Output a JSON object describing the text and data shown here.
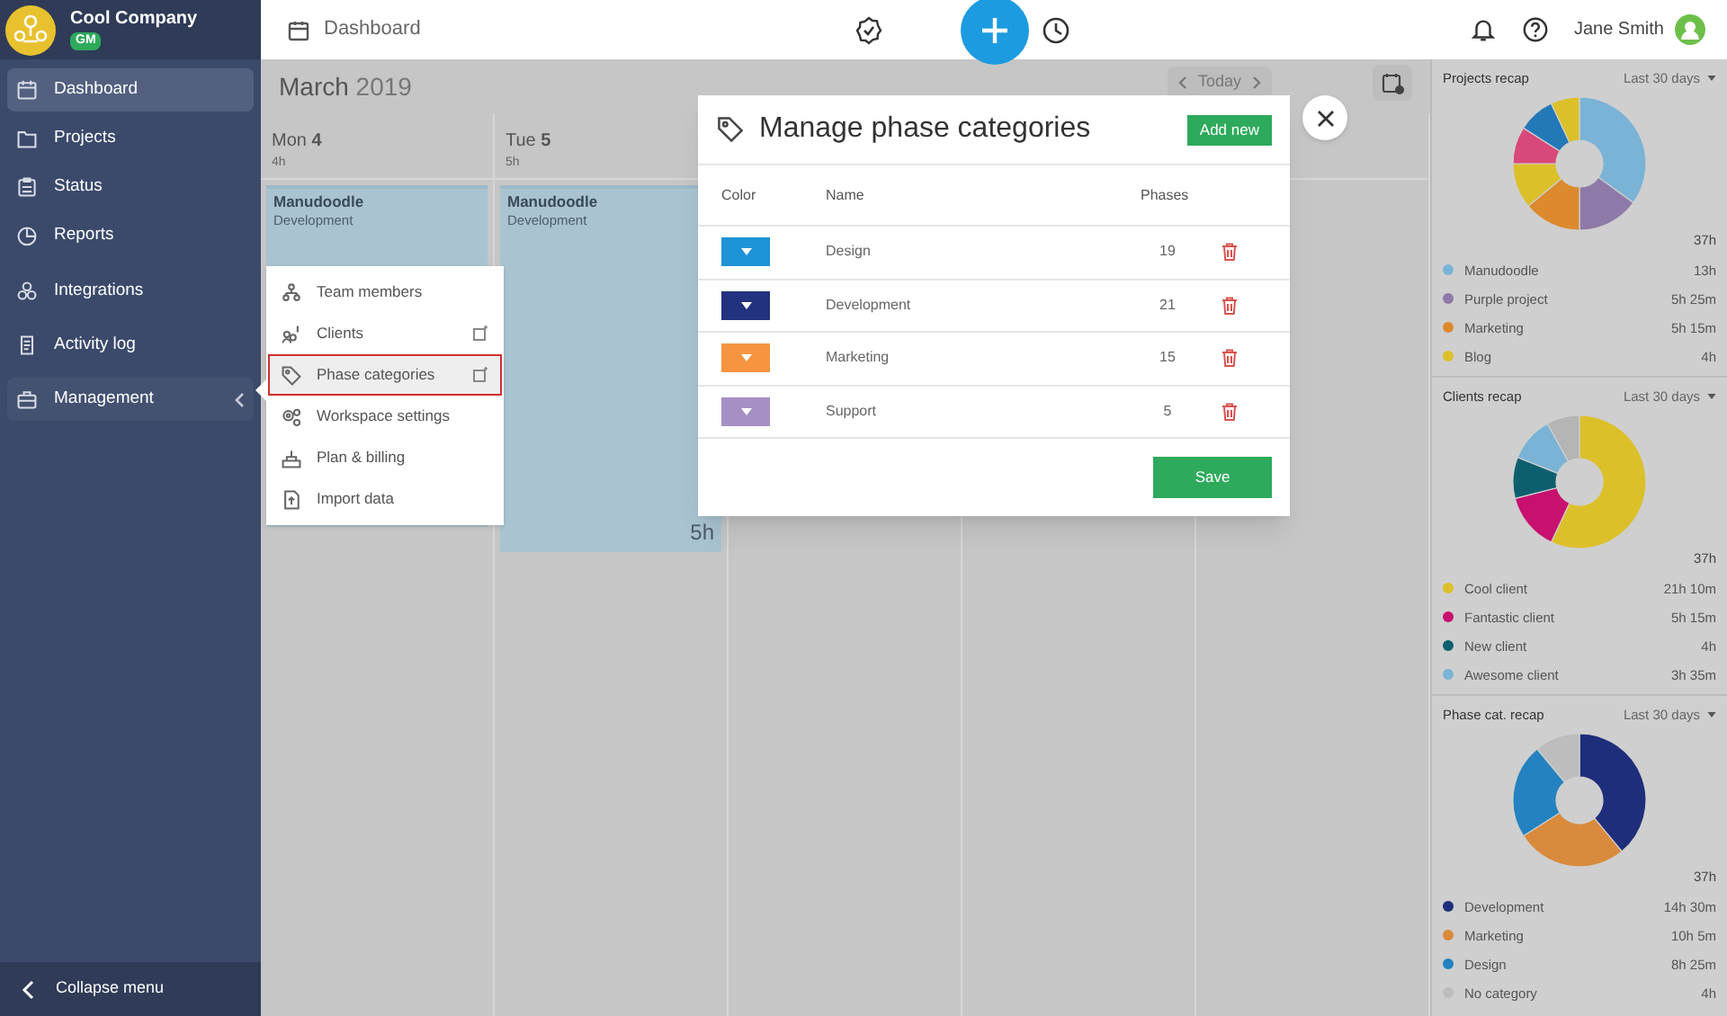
{
  "company": {
    "name": "Cool Company",
    "badge": "GM"
  },
  "sidebar": {
    "items": [
      {
        "label": "Dashboard",
        "kind": "calendar",
        "selected": true
      },
      {
        "label": "Projects",
        "kind": "folder",
        "selected": false
      },
      {
        "label": "Status",
        "kind": "clipboard",
        "selected": false
      },
      {
        "label": "Reports",
        "kind": "pie",
        "selected": false
      },
      {
        "label": "Integrations",
        "kind": "cubes",
        "selected": false
      },
      {
        "label": "Activity log",
        "kind": "scroll",
        "selected": false
      },
      {
        "label": "Management",
        "kind": "toolbox",
        "selected": false,
        "expanded": true
      }
    ],
    "collapse": "Collapse menu"
  },
  "topbar": {
    "title": "Dashboard",
    "user": "Jane Smith"
  },
  "calendar": {
    "month": "March",
    "year": "2019",
    "today": "Today",
    "days": [
      {
        "weekday": "Mon",
        "day": "4",
        "total": "4h",
        "events": [
          {
            "project": "Manudoodle",
            "phase": "Development"
          }
        ]
      },
      {
        "weekday": "Tue",
        "day": "5",
        "total": "5h",
        "events": [
          {
            "project": "Manudoodle",
            "phase": "Development",
            "duration": "5h"
          }
        ]
      }
    ]
  },
  "management_menu": {
    "items": [
      {
        "label": "Team members",
        "kind": "org",
        "external": false,
        "selected": false
      },
      {
        "label": "Clients",
        "kind": "clients",
        "external": true,
        "selected": false
      },
      {
        "label": "Phase categories",
        "kind": "tag",
        "external": true,
        "selected": true
      },
      {
        "label": "Workspace settings",
        "kind": "gears",
        "external": false,
        "selected": false
      },
      {
        "label": "Plan & billing",
        "kind": "billing",
        "external": false,
        "selected": false
      },
      {
        "label": "Import data",
        "kind": "import",
        "external": false,
        "selected": false
      }
    ]
  },
  "modal": {
    "title": "Manage phase categories",
    "add_button": "Add new",
    "columns": [
      "Color",
      "Name",
      "Phases"
    ],
    "rows": [
      {
        "color": "#1e93d6",
        "name": "Design",
        "phases": "19"
      },
      {
        "color": "#23327e",
        "name": "Development",
        "phases": "21"
      },
      {
        "color": "#f6943f",
        "name": "Marketing",
        "phases": "15"
      },
      {
        "color": "#a68fc4",
        "name": "Support",
        "phases": "5"
      }
    ],
    "save_button": "Save"
  },
  "recaps": [
    {
      "title": "Projects recap",
      "period": "Last 30 days",
      "total": "37h",
      "items": [
        {
          "label": "Manudoodle",
          "value": "13h",
          "color": "#7ab3d6"
        },
        {
          "label": "Purple project",
          "value": "5h 25m",
          "color": "#8e7aa8"
        },
        {
          "label": "Marketing",
          "value": "5h 15m",
          "color": "#dc8a2c"
        },
        {
          "label": "Blog",
          "value": "4h",
          "color": "#dcc02a"
        }
      ]
    },
    {
      "title": "Clients recap",
      "period": "Last 30 days",
      "total": "37h",
      "items": [
        {
          "label": "Cool client",
          "value": "21h 10m",
          "color": "#dcc02a"
        },
        {
          "label": "Fantastic client",
          "value": "5h 15m",
          "color": "#c8106f"
        },
        {
          "label": "New client",
          "value": "4h",
          "color": "#0e5f6e"
        },
        {
          "label": "Awesome client",
          "value": "3h 35m",
          "color": "#7ab3d6"
        }
      ]
    },
    {
      "title": "Phase cat. recap",
      "period": "Last 30 days",
      "total": "37h",
      "items": [
        {
          "label": "Development",
          "value": "14h 30m",
          "color": "#1e2e7a"
        },
        {
          "label": "Marketing",
          "value": "10h 5m",
          "color": "#d98a3c"
        },
        {
          "label": "Design",
          "value": "8h 25m",
          "color": "#2382bf"
        },
        {
          "label": "No category",
          "value": "4h",
          "color": "#bdbdbd"
        }
      ]
    }
  ]
}
